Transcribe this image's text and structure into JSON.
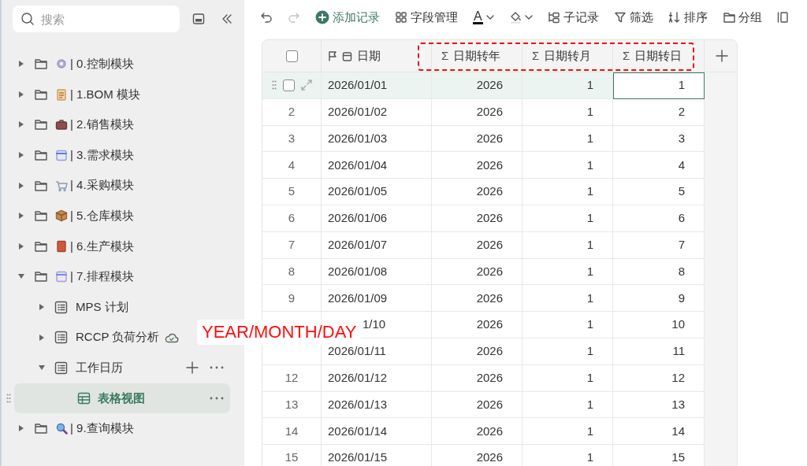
{
  "sidebar": {
    "search": {
      "placeholder": "搜索"
    },
    "tree": [
      {
        "label": "| 0.控制模块",
        "expanded": false,
        "selected": false
      },
      {
        "label": "| 1.BOM 模块",
        "expanded": false,
        "selected": false
      },
      {
        "label": "| 2.销售模块",
        "expanded": false,
        "selected": false
      },
      {
        "label": "| 3.需求模块",
        "expanded": false,
        "selected": false
      },
      {
        "label": "| 4.采购模块",
        "expanded": false,
        "selected": false
      },
      {
        "label": "| 5.仓库模块",
        "expanded": false,
        "selected": false
      },
      {
        "label": "| 6.生产模块",
        "expanded": false,
        "selected": false
      },
      {
        "label": "| 7.排程模块",
        "expanded": true,
        "selected": false,
        "children": [
          {
            "label": "MPS 计划",
            "expanded": false,
            "selected": false
          },
          {
            "label": "RCCP 负荷分析",
            "expanded": false,
            "selected": false,
            "synced": true
          },
          {
            "label": "工作日历",
            "expanded": true,
            "selected": false,
            "add_button": true,
            "more_button": true,
            "children": [
              {
                "label": "表格视图",
                "selected": true,
                "add_button": false,
                "more_button": true
              }
            ]
          }
        ]
      },
      {
        "label": "| 9.查询模块",
        "expanded": false,
        "selected": false
      }
    ]
  },
  "toolbar": [
    {
      "kind": "undo",
      "disabled": false
    },
    {
      "kind": "redo",
      "disabled": true
    },
    {
      "kind": "add",
      "label": "添加记录"
    },
    {
      "kind": "fields",
      "label": "字段管理"
    },
    {
      "kind": "text_color",
      "glyph": "A"
    },
    {
      "kind": "fill_color"
    },
    {
      "kind": "subrecord",
      "label": "子记录"
    },
    {
      "kind": "filter",
      "label": "筛选"
    },
    {
      "kind": "sort",
      "label": "排序"
    },
    {
      "kind": "group",
      "label": "分组"
    },
    {
      "kind": "columns"
    }
  ],
  "table": {
    "select_all": {
      "checked": false
    },
    "columns": [
      {
        "label": "日期",
        "kind": "date",
        "highlighted": false
      },
      {
        "label": "日期转年",
        "kind": "formula",
        "symbol": "Σ",
        "highlighted": true
      },
      {
        "label": "日期转月",
        "kind": "formula",
        "symbol": "Σ",
        "highlighted": true
      },
      {
        "label": "日期转日",
        "kind": "formula",
        "symbol": "Σ",
        "highlighted": true
      }
    ],
    "rows": [
      {
        "selected": true,
        "checked": false,
        "focused": true,
        "cells": [
          "2026/01/01",
          "2026",
          "1",
          "1"
        ]
      },
      {
        "num": "2",
        "selected": false,
        "focused": false,
        "cells": [
          "2026/01/02",
          "2026",
          "1",
          "2"
        ]
      },
      {
        "num": "3",
        "selected": false,
        "focused": false,
        "cells": [
          "2026/01/03",
          "2026",
          "1",
          "3"
        ]
      },
      {
        "num": "4",
        "selected": false,
        "focused": false,
        "cells": [
          "2026/01/04",
          "2026",
          "1",
          "4"
        ]
      },
      {
        "num": "5",
        "selected": false,
        "focused": false,
        "cells": [
          "2026/01/05",
          "2026",
          "1",
          "5"
        ]
      },
      {
        "num": "6",
        "selected": false,
        "focused": false,
        "cells": [
          "2026/01/06",
          "2026",
          "1",
          "6"
        ]
      },
      {
        "num": "7",
        "selected": false,
        "focused": false,
        "cells": [
          "2026/01/07",
          "2026",
          "1",
          "7"
        ]
      },
      {
        "num": "8",
        "selected": false,
        "focused": false,
        "cells": [
          "2026/01/08",
          "2026",
          "1",
          "8"
        ]
      },
      {
        "num": "9",
        "selected": false,
        "focused": false,
        "cells": [
          "2026/01/09",
          "2026",
          "1",
          "9"
        ]
      },
      {
        "selected": false,
        "focused": false,
        "cells": [
          "1/10",
          "2026",
          "1",
          "10"
        ]
      },
      {
        "selected": false,
        "focused": false,
        "cells": [
          "2026/01/11",
          "2026",
          "1",
          "11"
        ]
      },
      {
        "num": "12",
        "selected": false,
        "focused": false,
        "cells": [
          "2026/01/12",
          "2026",
          "1",
          "12"
        ]
      },
      {
        "num": "13",
        "selected": false,
        "focused": false,
        "cells": [
          "2026/01/13",
          "2026",
          "1",
          "13"
        ]
      },
      {
        "num": "14",
        "selected": false,
        "focused": false,
        "cells": [
          "2026/01/14",
          "2026",
          "1",
          "14"
        ]
      },
      {
        "num": "15",
        "selected": false,
        "focused": false,
        "cells": [
          "2026/01/15",
          "2026",
          "1",
          "15"
        ]
      }
    ]
  },
  "annotation": {
    "text": "YEAR/MONTH/DAY"
  }
}
